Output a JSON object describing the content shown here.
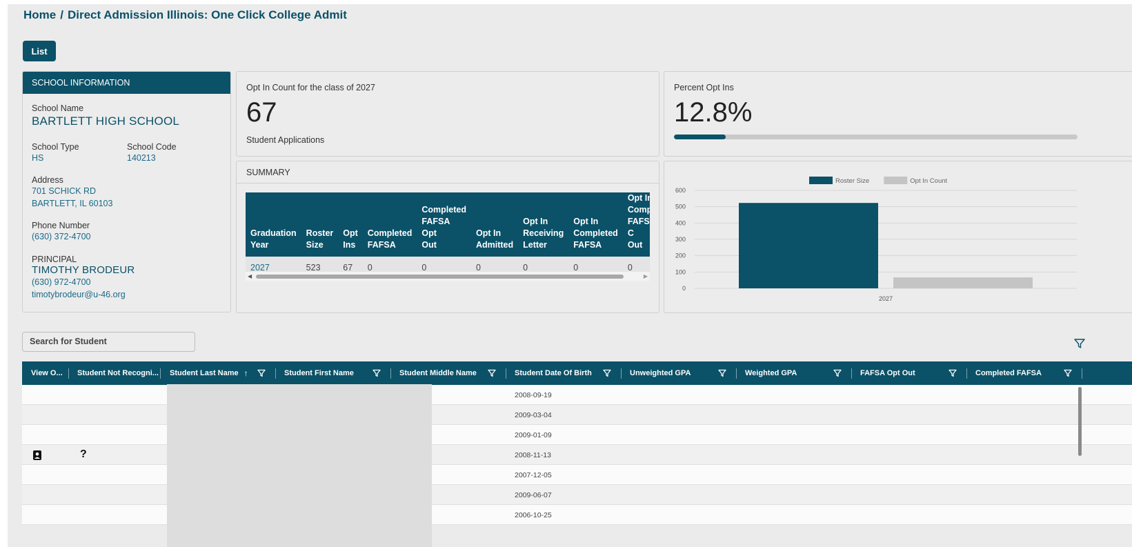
{
  "breadcrumb": {
    "home": "Home",
    "separator": "/",
    "current": "Direct Admission Illinois: One Click College Admit"
  },
  "list_button": "List",
  "school_info": {
    "header": "SCHOOL INFORMATION",
    "school_name_label": "School Name",
    "school_name": "BARTLETT HIGH SCHOOL",
    "school_type_label": "School Type",
    "school_type": "HS",
    "school_code_label": "School Code",
    "school_code": "140213",
    "address_label": "Address",
    "address_line1": "701 SCHICK RD",
    "address_line2": "BARTLETT, IL 60103",
    "phone_label": "Phone Number",
    "phone": "(630) 372-4700",
    "principal_label": "PRINCIPAL",
    "principal_name": "TIMOTHY BRODEUR",
    "principal_phone": "(630) 972-4700",
    "principal_email": "timotybrodeur@u-46.org"
  },
  "opt_in_card": {
    "title": "Opt In Count for the class of 2027",
    "value": "67",
    "subtitle": "Student Applications"
  },
  "percent_card": {
    "title": "Percent Opt Ins",
    "value": "12.8%",
    "fraction": 0.128
  },
  "summary": {
    "header": "SUMMARY",
    "columns": [
      [
        "Graduation",
        "Year"
      ],
      [
        "Roster",
        "Size"
      ],
      [
        "Opt",
        "Ins"
      ],
      [
        "Completed",
        "FAFSA"
      ],
      [
        "Completed",
        "FAFSA Opt",
        "Out"
      ],
      [
        "Opt In",
        "Admitted"
      ],
      [
        "Opt In",
        "Receiving",
        "Letter"
      ],
      [
        "Opt In",
        "Completed",
        "FAFSA"
      ],
      [
        "Opt In",
        "Comple",
        "FAFSA C",
        "Out"
      ]
    ],
    "row": [
      "2027",
      "523",
      "67",
      "0",
      "0",
      "0",
      "0",
      "0",
      "0"
    ]
  },
  "chart_data": {
    "type": "bar",
    "categories": [
      "2027"
    ],
    "series": [
      {
        "name": "Roster Size",
        "values": [
          523
        ],
        "color": "#0b5168"
      },
      {
        "name": "Opt In Count",
        "values": [
          67
        ],
        "color": "#c4c4c4"
      }
    ],
    "ylim": [
      0,
      600
    ],
    "yticks": [
      0,
      100,
      200,
      300,
      400,
      500,
      600
    ],
    "legend": "top-center",
    "grid": true
  },
  "search": {
    "placeholder": "Search for Student"
  },
  "grid": {
    "columns": [
      "View O...",
      "Student Not Recogni...",
      "Student Last Name",
      "Student First Name",
      "Student Middle Name",
      "Student Date Of Birth",
      "Unweighted GPA",
      "Weighted GPA",
      "FAFSA Opt Out",
      "Completed FAFSA"
    ],
    "sort_icon": "arrow-up-icon",
    "rows": [
      {
        "dob": "2008-09-19"
      },
      {
        "dob": "2009-03-04"
      },
      {
        "dob": "2009-01-09"
      },
      {
        "dob": "2008-11-13",
        "view_icon": "profile-icon",
        "not_recognized": "?"
      },
      {
        "dob": "2007-12-05"
      },
      {
        "dob": "2009-06-07"
      },
      {
        "dob": "2006-10-25"
      }
    ]
  },
  "colors": {
    "primary": "#0b5168",
    "link": "#1a6a88",
    "page_bg": "#ebebeb",
    "bar_secondary": "#c4c4c4"
  }
}
